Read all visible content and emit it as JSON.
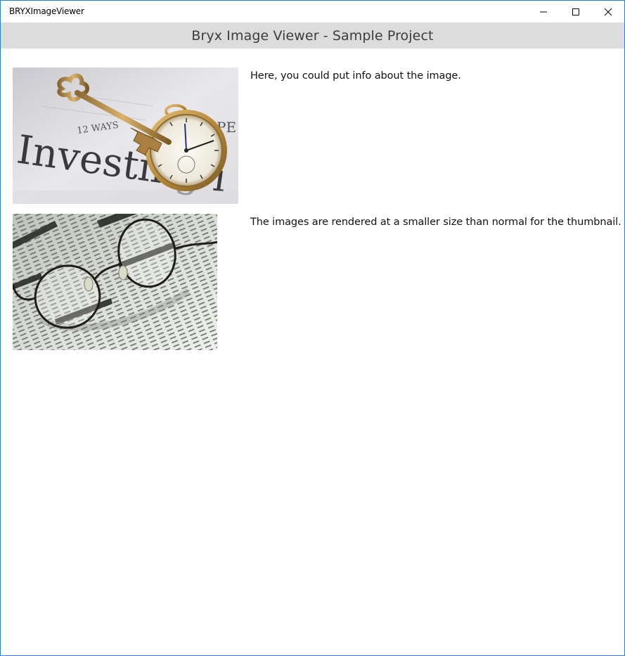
{
  "window": {
    "title": "BRYXImageViewer",
    "controls": [
      "minimize-icon",
      "maximize-icon",
      "close-icon"
    ]
  },
  "header": {
    "title": "Bryx Image Viewer - Sample Project"
  },
  "items": [
    {
      "image_text": [
        "12 WAYS",
        "Investing i",
        "PE"
      ],
      "caption": "Here, you could put info about the image."
    },
    {
      "image_text": [],
      "caption": "The images are rendered at a smaller size than normal for the thumbnail."
    }
  ],
  "colors": {
    "window_border": "#2b7fd6",
    "header_bg": "#dcdcdc",
    "header_text": "#3c3c3c"
  }
}
